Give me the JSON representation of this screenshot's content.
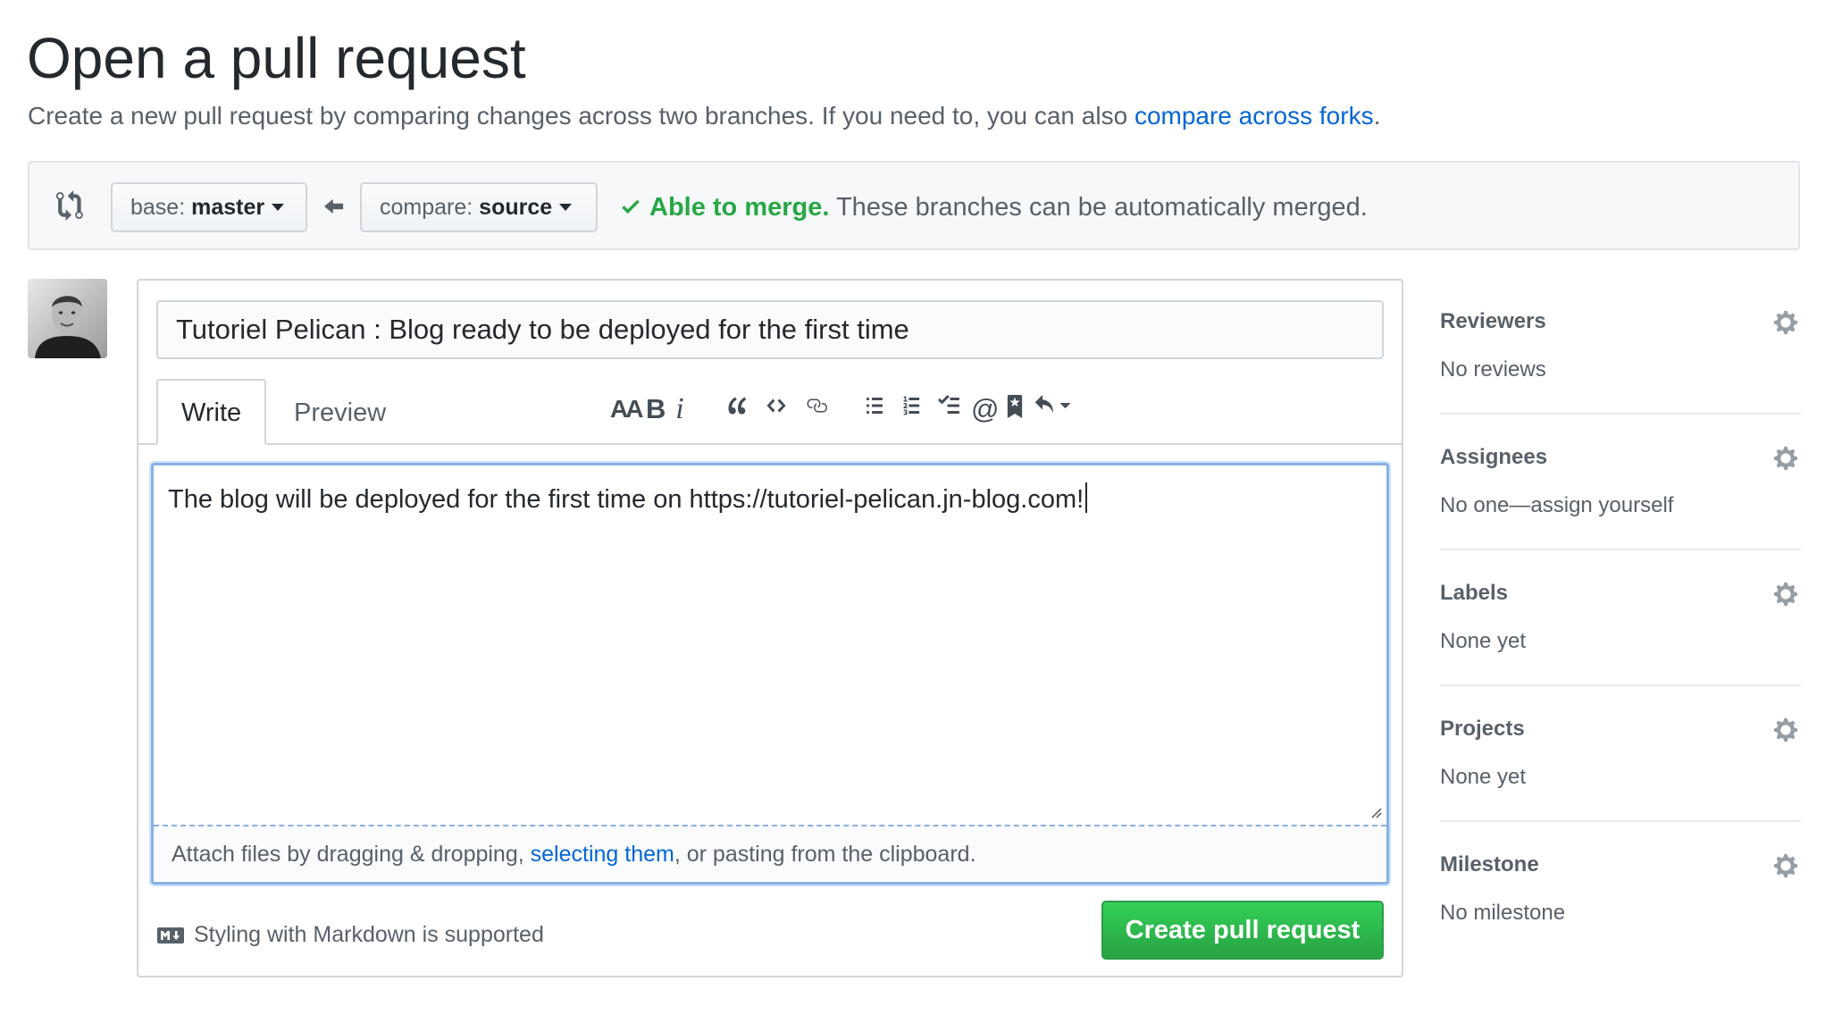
{
  "page": {
    "title": "Open a pull request",
    "subtitle_prefix": "Create a new pull request by comparing changes across two branches. If you need to, you can also ",
    "subtitle_link": "compare across forks",
    "subtitle_suffix": "."
  },
  "range": {
    "base_prefix": "base: ",
    "base_branch": "master",
    "compare_prefix": "compare: ",
    "compare_branch": "source",
    "merge_ok": "Able to merge.",
    "merge_detail": " These branches can be automatically merged."
  },
  "form": {
    "title_value": "Tutoriel Pelican : Blog ready to be deployed for the first time",
    "tabs": [
      "Write",
      "Preview"
    ],
    "toolbar": {
      "header": "AA",
      "bold": "B",
      "italic": "i",
      "mention": "@"
    },
    "body_value": "The blog will be deployed for the first time on https://tutoriel-pelican.jn-blog.com!",
    "attach_prefix": "Attach files by dragging & dropping, ",
    "attach_link": "selecting them",
    "attach_suffix": ", or pasting from the clipboard.",
    "markdown_note": "Styling with Markdown is supported",
    "submit_label": "Create pull request"
  },
  "sidebar": {
    "sections": [
      {
        "heading": "Reviewers",
        "value": "No reviews"
      },
      {
        "heading": "Assignees",
        "value": "No one—assign yourself"
      },
      {
        "heading": "Labels",
        "value": "None yet"
      },
      {
        "heading": "Projects",
        "value": "None yet"
      },
      {
        "heading": "Milestone",
        "value": "No milestone"
      }
    ]
  },
  "colors": {
    "link": "#0366d6",
    "success": "#28a745",
    "focus_border": "#8ab1e0"
  },
  "icons": [
    "git-compare-icon",
    "arrow-left-icon",
    "check-icon",
    "gear-icon",
    "markdown-icon",
    "quote-icon",
    "code-icon",
    "link-icon",
    "unordered-list-icon",
    "ordered-list-icon",
    "task-list-icon",
    "bookmark-icon",
    "reply-icon"
  ]
}
